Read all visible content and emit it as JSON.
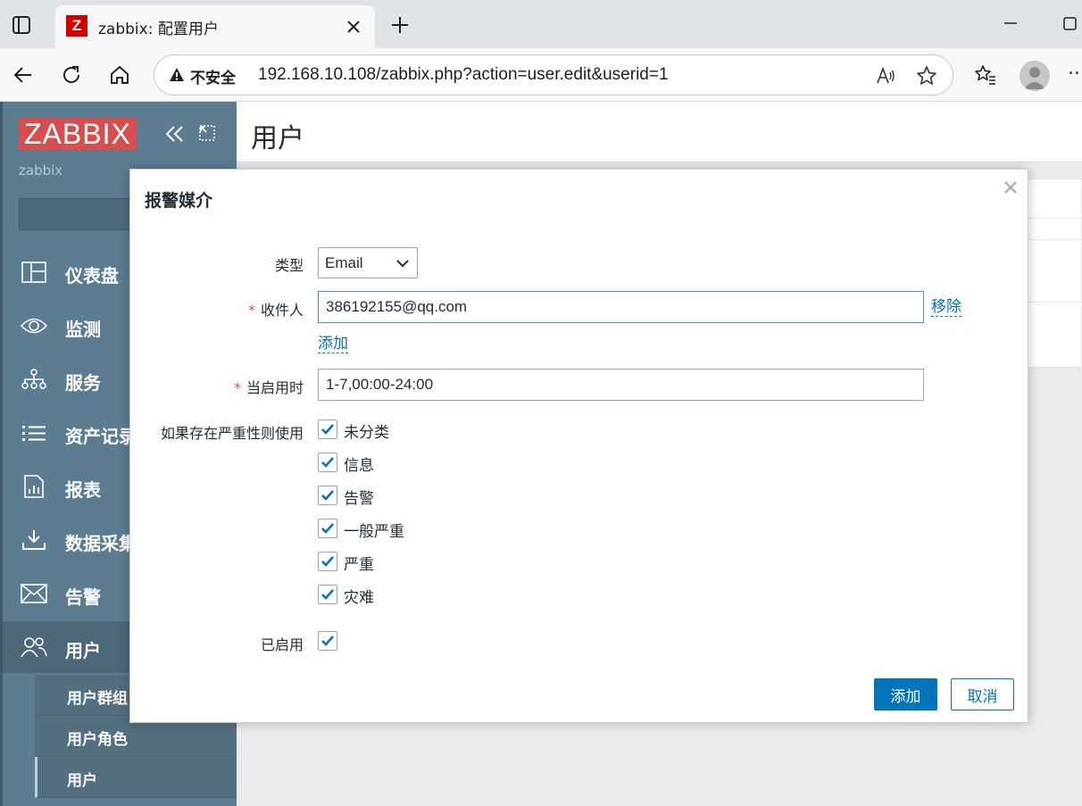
{
  "browser": {
    "tab_title": "zabbix: 配置用户",
    "favicon_letter": "Z",
    "security_label": "不安全",
    "url": "192.168.10.108/zabbix.php?action=user.edit&userid=1",
    "more_label": "..."
  },
  "sidebar": {
    "logo": "ZABBIX",
    "server_name": "zabbix",
    "items": [
      {
        "label": "仪表盘",
        "icon": "dashboard-icon"
      },
      {
        "label": "监测",
        "icon": "eye-icon"
      },
      {
        "label": "服务",
        "icon": "services-icon"
      },
      {
        "label": "资产记录",
        "icon": "list-icon"
      },
      {
        "label": "报表",
        "icon": "report-icon"
      },
      {
        "label": "数据采集",
        "icon": "download-icon"
      },
      {
        "label": "告警",
        "icon": "mail-icon"
      },
      {
        "label": "用户",
        "icon": "users-icon"
      }
    ],
    "subitems": [
      {
        "label": "用户群组"
      },
      {
        "label": "用户角色"
      },
      {
        "label": "用户"
      }
    ]
  },
  "main": {
    "page_title": "用户"
  },
  "dialog": {
    "title": "报警媒介",
    "type_label": "类型",
    "type_value": "Email",
    "recipient_label": "收件人",
    "recipient_value": "386192155@qq.com",
    "remove_link": "移除",
    "add_link": "添加",
    "when_active_label": "当启用时",
    "when_active_value": "1-7,00:00-24:00",
    "severity_label": "如果存在严重性则使用",
    "severities": [
      {
        "label": "未分类",
        "checked": true
      },
      {
        "label": "信息",
        "checked": true
      },
      {
        "label": "告警",
        "checked": true
      },
      {
        "label": "一般严重",
        "checked": true
      },
      {
        "label": "严重",
        "checked": true
      },
      {
        "label": "灾难",
        "checked": true
      }
    ],
    "enabled_label": "已启用",
    "enabled_checked": true,
    "add_button": "添加",
    "cancel_button": "取消"
  },
  "colors": {
    "sidebar_bg": "#5c7d91",
    "logo_bg": "#d64e4e",
    "primary": "#0275b8",
    "required": "#d64e4e"
  }
}
